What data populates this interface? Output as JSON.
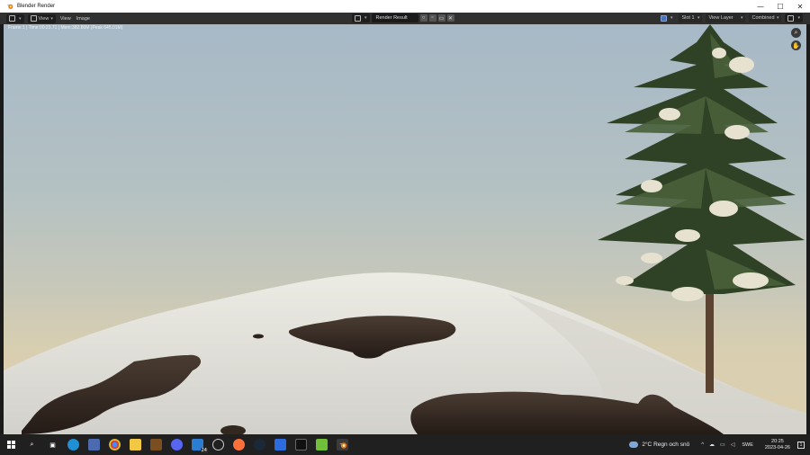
{
  "window": {
    "title": "Blender Render",
    "controls": [
      "—",
      "☐",
      "✕"
    ]
  },
  "header": {
    "menus": [
      "View",
      "View",
      "Image"
    ],
    "image_name": "Render Result",
    "slot": "Slot 1",
    "view_layer": "View Layer",
    "pass": "Combined"
  },
  "viewport": {
    "stats": "Frame:1 | Time:00:23.71 | Mem:382.80M (Peak 645.01M)"
  },
  "taskbar": {
    "weather_temp": "2°C",
    "weather_text": "Regn och snö",
    "lang": "SWE",
    "time": "20:25",
    "date": "2023-04-26",
    "badge": "24",
    "notification_count": "1"
  },
  "colors": {
    "accent": "#e87d0d",
    "header_bg": "#303030",
    "taskbar_bg": "#202020",
    "sky_top": "#a7b9c7",
    "sky_bottom": "#dccfaf"
  }
}
